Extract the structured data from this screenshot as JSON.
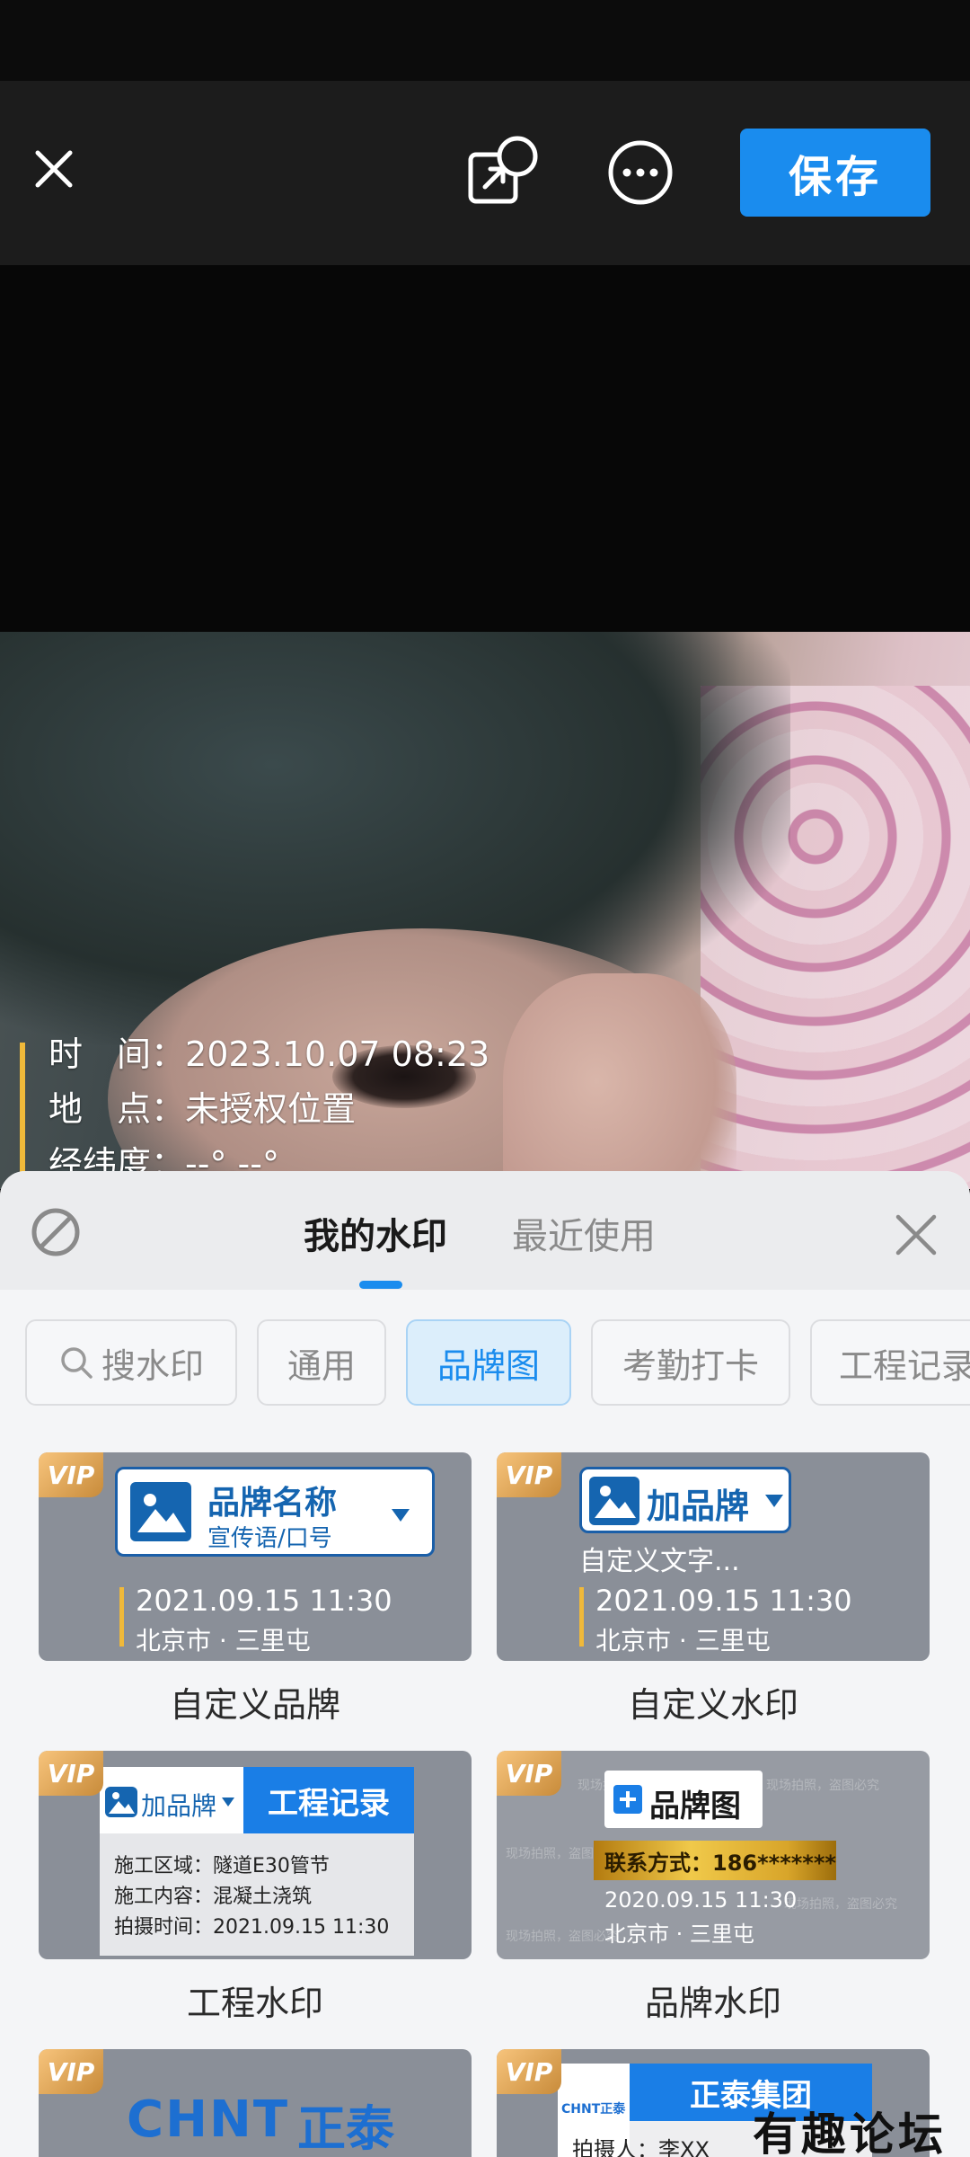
{
  "toolbar": {
    "save_label": "保存",
    "close_icon": "close-icon",
    "share_icon": "external-share-icon",
    "more_icon": "more-options-icon",
    "accent": "#1a8cee"
  },
  "photo_watermark": {
    "time_label": "时　间：",
    "time_value": "2023.10.07 08:23",
    "place_label": "地　点：",
    "place_value": "未授权位置",
    "coord_label": "经纬度：",
    "coord_value": "--°,--°",
    "bar_color": "#f0b93a"
  },
  "sheet": {
    "tabs": [
      {
        "label": "我的水印",
        "active": true
      },
      {
        "label": "最近使用",
        "active": false
      }
    ],
    "search_placeholder": "搜水印",
    "chips": [
      {
        "label": "通用",
        "active": false
      },
      {
        "label": "品牌图",
        "active": true
      },
      {
        "label": "考勤打卡",
        "active": false
      },
      {
        "label": "工程记录",
        "active": false
      }
    ]
  },
  "cards": {
    "custom_brand": {
      "title": "自定义品牌",
      "vip": "VIP",
      "brand_name": "品牌名称",
      "slogan": "宣传语/口号",
      "date": "2021.09.15  11:30",
      "place": "北京市 · 三里屯"
    },
    "custom_watermark": {
      "title": "自定义水印",
      "vip": "VIP",
      "brand_name": "加品牌",
      "custom_text": "自定义文字...",
      "date": "2021.09.15  11:30",
      "place": "北京市 · 三里屯"
    },
    "engineering": {
      "title": "工程水印",
      "vip": "VIP",
      "brand_name": "加品牌",
      "badge": "工程记录",
      "area": "施工区域：隧道E30管节",
      "content": "施工内容：混凝土浇筑",
      "time": "拍摄时间：2021.09.15 11:30"
    },
    "brand_wm": {
      "title": "品牌水印",
      "vip": "VIP",
      "brand_name": "品牌图",
      "contact": "联系方式：186*******",
      "date": "2020.09.15  11:30",
      "place": "北京市 · 三里屯",
      "bg_text": "现场拍照，盗图必究"
    },
    "chnt_1": {
      "vip": "VIP",
      "logo": "CHNT",
      "logo_cn": "正泰"
    },
    "chnt_2": {
      "vip": "VIP",
      "logo_small": "CHNT正泰",
      "group": "正泰集团",
      "photographer": "拍摄人：李XX"
    }
  },
  "overlay": {
    "forum_mark": "有趣论坛"
  }
}
